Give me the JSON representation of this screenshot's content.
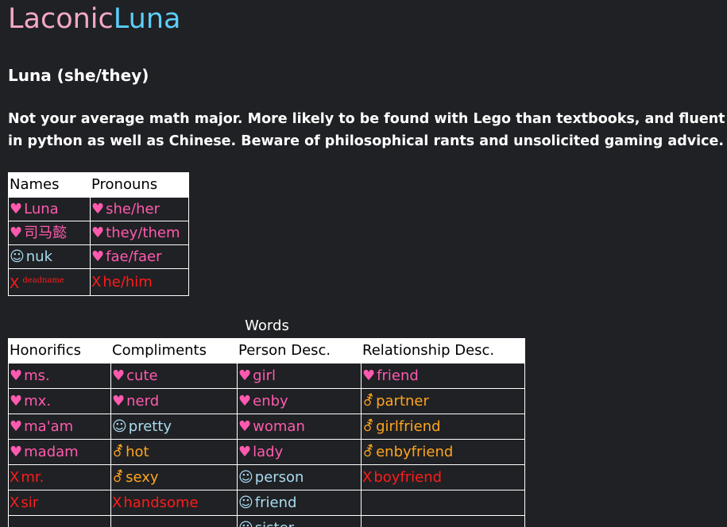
{
  "site": {
    "title_part1": "Laconic",
    "title_part2": "Luna",
    "title_color1": "#f4a8c7",
    "title_color2": "#5bcefa"
  },
  "profile": {
    "name": "Luna (she/they)",
    "bio": "Not your average math major. More likely to be found with Lego than textbooks, and fluent in python as well as Chinese. Beware of philosophical rants and unsolicited gaming advice."
  },
  "legend_colors": {
    "yes": "#ff5aaf",
    "okay": "#a9dbf0",
    "close": "#ffa51e",
    "no": "#ff1b1b"
  },
  "icons": {
    "yes": "♥",
    "okay": "☺",
    "close": "⚦",
    "no": "X"
  },
  "names_table": {
    "headers": [
      "Names",
      "Pronouns"
    ],
    "rows": [
      {
        "name_icon": "♥",
        "name": "Luna",
        "pronoun_icon": "♥",
        "pronoun": "she/her"
      },
      {
        "name_icon": "♥",
        "name": "司马懿",
        "pronoun_icon": "♥",
        "pronoun": "they/them"
      },
      {
        "name_icon": "☺",
        "name": "nuk",
        "pronoun_icon": "♥",
        "pronoun": "fae/faer"
      },
      {
        "name_icon": "X",
        "name": "deadname",
        "pronoun_icon": "X",
        "pronoun": "he/him"
      }
    ]
  },
  "words_table": {
    "caption": "Words",
    "headers": [
      "Honorifics",
      "Compliments",
      "Person Desc.",
      "Relationship Desc."
    ],
    "honorifics": [
      {
        "icon": "♥",
        "text": "ms."
      },
      {
        "icon": "♥",
        "text": "mx."
      },
      {
        "icon": "♥",
        "text": "ma'am"
      },
      {
        "icon": "♥",
        "text": "madam"
      },
      {
        "icon": "X",
        "text": "mr."
      },
      {
        "icon": "X",
        "text": "sir"
      }
    ],
    "compliments": [
      {
        "icon": "♥",
        "text": "cute"
      },
      {
        "icon": "♥",
        "text": "nerd"
      },
      {
        "icon": "☺",
        "text": "pretty"
      },
      {
        "icon": "⚦",
        "text": "hot"
      },
      {
        "icon": "⚦",
        "text": "sexy"
      },
      {
        "icon": "X",
        "text": "handsome"
      }
    ],
    "person": [
      {
        "icon": "♥",
        "text": "girl"
      },
      {
        "icon": "♥",
        "text": "enby"
      },
      {
        "icon": "♥",
        "text": "woman"
      },
      {
        "icon": "♥",
        "text": "lady"
      },
      {
        "icon": "☺",
        "text": "person"
      },
      {
        "icon": "☺",
        "text": "friend"
      },
      {
        "icon": "☺",
        "text": "sister"
      }
    ],
    "relationship": [
      {
        "icon": "♥",
        "text": "friend"
      },
      {
        "icon": "⚦",
        "text": "partner"
      },
      {
        "icon": "⚦",
        "text": "girlfriend"
      },
      {
        "icon": "⚦",
        "text": "enbyfriend"
      },
      {
        "icon": "X",
        "text": "boyfriend"
      }
    ]
  }
}
